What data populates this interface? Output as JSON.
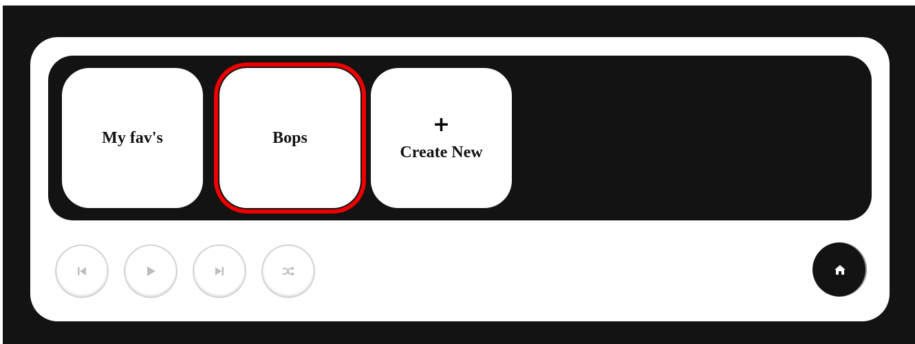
{
  "playlists": [
    {
      "label": "My fav's"
    },
    {
      "label": "Bops",
      "selected": true
    },
    {
      "label": "Create New",
      "icon": "plus-icon",
      "icon_glyph": "+"
    }
  ],
  "controls": [
    {
      "name": "previous",
      "icon": "skip-previous-icon"
    },
    {
      "name": "play",
      "icon": "play-icon"
    },
    {
      "name": "next",
      "icon": "skip-next-icon"
    },
    {
      "name": "shuffle",
      "icon": "shuffle-icon"
    }
  ],
  "home": {
    "icon": "home-icon"
  },
  "colors": {
    "background": "#131313",
    "panel": "#ffffff",
    "selection_outline": "#ee0000",
    "control_icon": "#bdbdbd"
  }
}
